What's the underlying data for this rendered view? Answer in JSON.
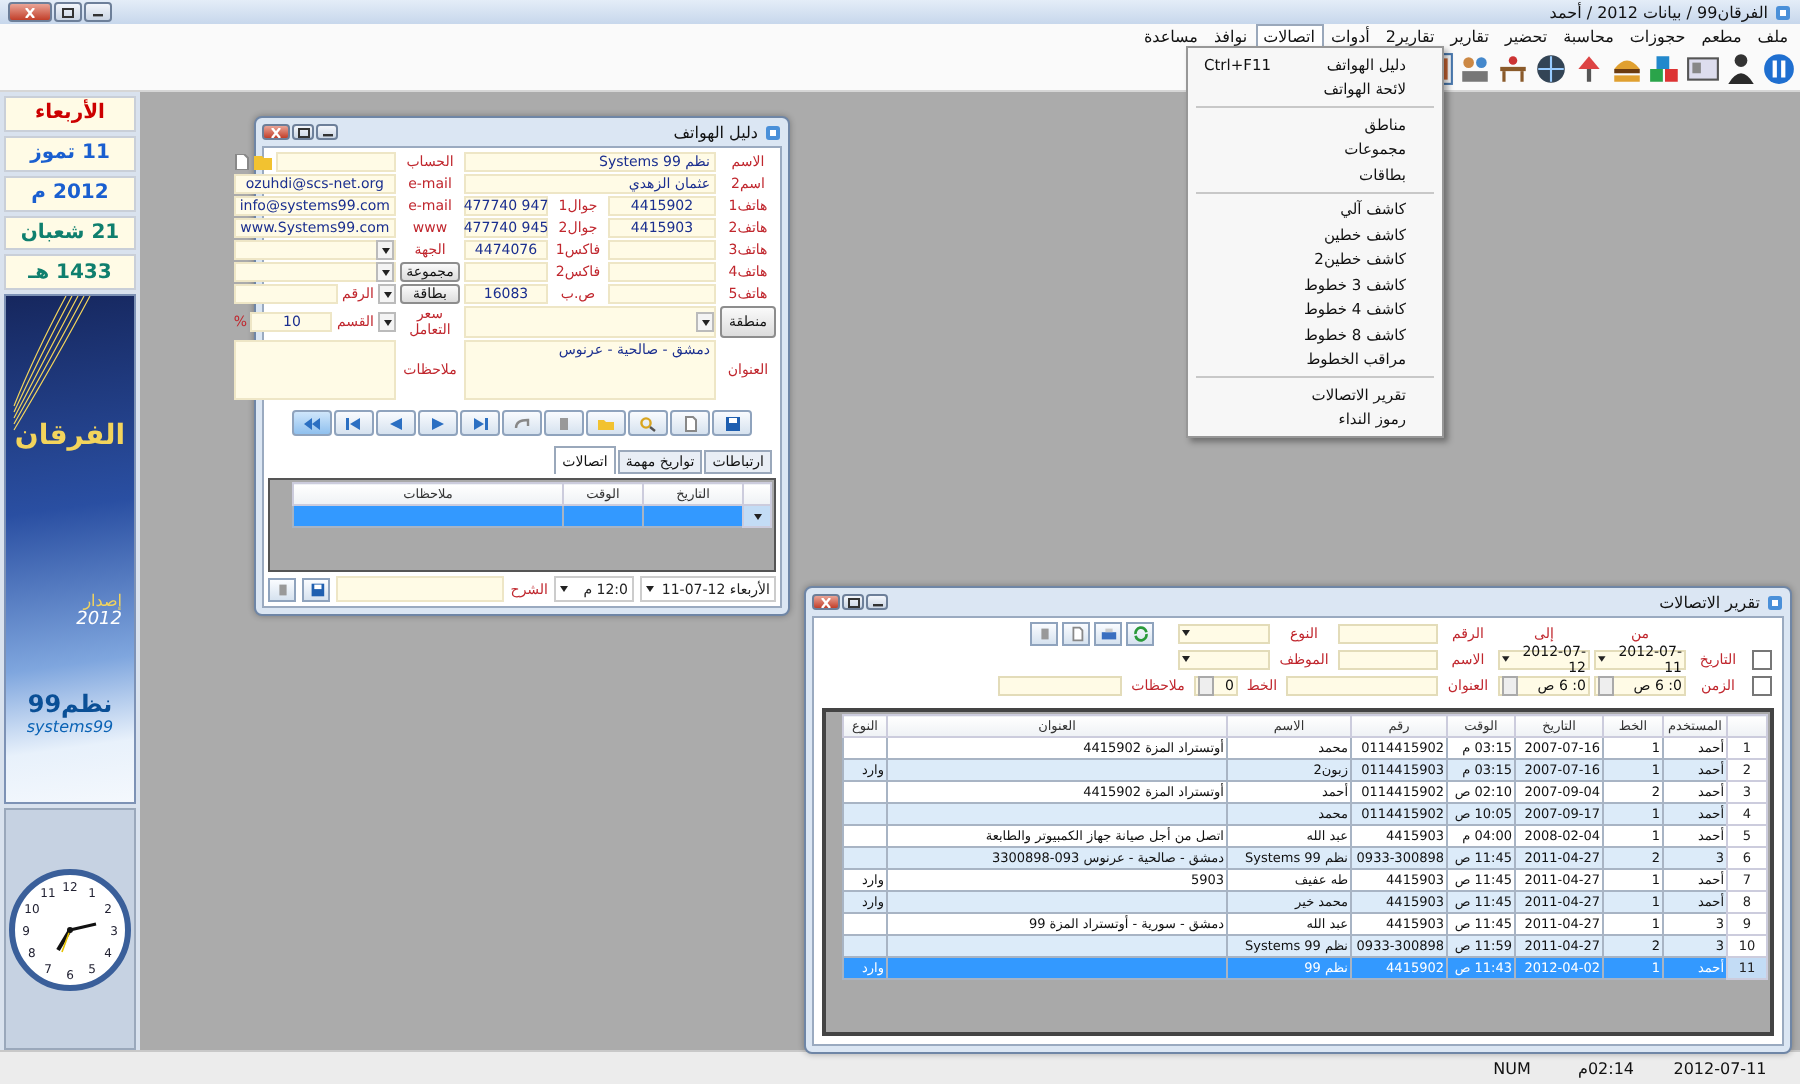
{
  "window": {
    "title": "الفرقان99 / بيانات 2012 / أحمد"
  },
  "menu": [
    {
      "label": "ملف",
      "selected": false
    },
    {
      "label": "مطعم",
      "selected": false
    },
    {
      "label": "حجوزات",
      "selected": false
    },
    {
      "label": "محاسبة",
      "selected": false
    },
    {
      "label": "تحضير",
      "selected": false
    },
    {
      "label": "تقارير",
      "selected": false
    },
    {
      "label": "تقارير2",
      "selected": false
    },
    {
      "label": "أدوات",
      "selected": false
    },
    {
      "label": "اتصالات",
      "selected": true
    },
    {
      "label": "نوافذ",
      "selected": false
    },
    {
      "label": "مساعدة",
      "selected": false
    }
  ],
  "dropdown": [
    {
      "kind": "item",
      "label": "دليل الهواتف",
      "shortcut": "Ctrl+F11"
    },
    {
      "kind": "item",
      "label": "لائحة الهواتف"
    },
    {
      "kind": "separator"
    },
    {
      "kind": "item",
      "label": "مناطق"
    },
    {
      "kind": "item",
      "label": "مجموعات"
    },
    {
      "kind": "item",
      "label": "بطاقات"
    },
    {
      "kind": "separator"
    },
    {
      "kind": "item",
      "label": "كاشف آلي"
    },
    {
      "kind": "item",
      "label": "كاشف خطين"
    },
    {
      "kind": "item",
      "label": "كاشف خطين2"
    },
    {
      "kind": "item",
      "label": "كاشف 3 خطوط"
    },
    {
      "kind": "item",
      "label": "كاشف 4 خطوط"
    },
    {
      "kind": "item",
      "label": "كاشف 8 خطوط"
    },
    {
      "kind": "item",
      "label": "مراقب الخطوط"
    },
    {
      "kind": "separator"
    },
    {
      "kind": "item",
      "label": "تقرير الاتصالات"
    },
    {
      "kind": "item",
      "label": "رموز النداء"
    }
  ],
  "sidebar": {
    "dates": [
      {
        "text": "الأربعاء",
        "color": "#cc0000"
      },
      {
        "text": "11 تموز",
        "color": "#1a5fd0"
      },
      {
        "text": "2012 م",
        "color": "#1a5fd0"
      },
      {
        "text": "21 شعبان",
        "color": "#0f7f6e"
      },
      {
        "text": "1433 هـ",
        "color": "#0f7f6e"
      }
    ],
    "banner": {
      "title": "الفرقان",
      "edition": "إصدار",
      "year": "2012",
      "brand": "نظم99",
      "brand_latin": "systems99"
    },
    "clock": {
      "numerals": [
        "12",
        "1",
        "2",
        "3",
        "4",
        "5",
        "6",
        "7",
        "8",
        "9",
        "10",
        "11"
      ]
    }
  },
  "phone_book": {
    "title": "دليل الهواتف",
    "form": [
      [
        {
          "kind": "label",
          "text": "الاسم"
        },
        {
          "kind": "wide_field",
          "value": "نظم 99 Systems"
        },
        {
          "kind": "label",
          "text": "الحساب"
        },
        {
          "kind": "icon_field"
        }
      ],
      [
        {
          "kind": "label",
          "text": "اسم2"
        },
        {
          "kind": "wide_field",
          "value": "عثمان الزهدي"
        },
        {
          "kind": "label",
          "text": "e-mail"
        },
        {
          "kind": "field",
          "value": "ozuhdi@scs-net.org"
        }
      ],
      [
        {
          "kind": "label",
          "text": "هاتف1"
        },
        {
          "kind": "field",
          "value": "4415902"
        },
        {
          "kind": "label",
          "text": "جوال1"
        },
        {
          "kind": "field",
          "value": "947 477740"
        },
        {
          "kind": "label",
          "text": "e-mail"
        },
        {
          "kind": "field",
          "value": "info@systems99.com"
        }
      ],
      [
        {
          "kind": "label",
          "text": "هاتف2"
        },
        {
          "kind": "field",
          "value": "4415903"
        },
        {
          "kind": "label",
          "text": "جوال2"
        },
        {
          "kind": "field",
          "value": "945 477740"
        },
        {
          "kind": "label",
          "text": "www"
        },
        {
          "kind": "field",
          "value": "www.Systems99.com"
        }
      ],
      [
        {
          "kind": "label",
          "text": "هاتف3"
        },
        {
          "kind": "field"
        },
        {
          "kind": "label",
          "text": "فاكس1"
        },
        {
          "kind": "field",
          "value": "4474076"
        },
        {
          "kind": "label",
          "text": "الجهة"
        },
        {
          "kind": "select"
        }
      ],
      [
        {
          "kind": "label",
          "text": "هاتف4"
        },
        {
          "kind": "field"
        },
        {
          "kind": "label",
          "text": "فاكس2"
        },
        {
          "kind": "field"
        },
        {
          "kind": "button",
          "text": "مجموعة"
        },
        {
          "kind": "select"
        }
      ],
      [
        {
          "kind": "label",
          "text": "هاتف5"
        },
        {
          "kind": "field"
        },
        {
          "kind": "label",
          "text": "ص.ب"
        },
        {
          "kind": "field",
          "value": "16083"
        },
        {
          "kind": "button",
          "text": "بطاقة"
        },
        {
          "kind": "number_select",
          "text": "الرقم"
        }
      ],
      [
        {
          "kind": "button",
          "text": "منطقة"
        },
        {
          "kind": "wide_select"
        },
        {
          "kind": "label",
          "text": "سعر التعامل"
        },
        {
          "kind": "percent_field",
          "text": "القسم",
          "value": "10",
          "unit": "%"
        }
      ],
      [
        {
          "kind": "label",
          "text": "العنوان"
        },
        {
          "kind": "wide_area",
          "value": "دمشق - صالحية - عرنوس"
        },
        {
          "kind": "label",
          "text": "ملاحظات"
        },
        {
          "kind": "area"
        }
      ]
    ],
    "tabs": [
      {
        "label": "ارتباطات",
        "selected": false
      },
      {
        "label": "تواريخ مهمة",
        "selected": false
      },
      {
        "label": "اتصالات",
        "selected": true
      }
    ],
    "grid": {
      "columns": [
        "التاريخ",
        "الوقت",
        "ملاحظات"
      ],
      "rows": [
        {
          "selected": true
        }
      ]
    },
    "footer": {
      "date": "الأربعاء 12-07-11",
      "time": "12:0 م",
      "description_label": "الشرح"
    }
  },
  "report": {
    "title": "تقرير الاتصالات",
    "filters": {
      "from_label": "من",
      "to_label": "إلى",
      "date": {
        "label": "التاريخ",
        "checked": false,
        "from": "2012-07-11",
        "to": "2012-07-12"
      },
      "time": {
        "label": "الزمن",
        "checked": false,
        "from": "0: 6 ص",
        "to": "0: 6 ص"
      },
      "number_label": "الرقم",
      "name_label": "الاسم",
      "address_label": "العنوان",
      "type_label": "النوع",
      "employee_label": "الموظف",
      "line": {
        "label": "الخط",
        "value": "0"
      },
      "notes_label": "ملاحظات"
    },
    "columns": [
      "المستخدم",
      "الخط",
      "التاريخ",
      "الوقت",
      "رقم",
      "الاسم",
      "العنوان",
      "النوع"
    ],
    "rows": [
      {
        "number": "1",
        "selected": false,
        "cells": [
          "أحمد",
          "1",
          "2007-07-16",
          "03:15 م",
          "0114415902",
          "محمد",
          "أوتستراد المزة 4415902",
          ""
        ]
      },
      {
        "number": "2",
        "selected": false,
        "cells": [
          "أحمد",
          "1",
          "2007-07-16",
          "03:15 م",
          "0114415903",
          "زبون2",
          "",
          "وارد"
        ]
      },
      {
        "number": "3",
        "selected": false,
        "cells": [
          "أحمد",
          "2",
          "2007-09-04",
          "02:10 ص",
          "0114415902",
          "أحمد",
          "أوتستراد المزة 4415902",
          ""
        ]
      },
      {
        "number": "4",
        "selected": false,
        "cells": [
          "أحمد",
          "1",
          "2007-09-17",
          "10:05 ص",
          "0114415902",
          "محمد",
          "",
          ""
        ]
      },
      {
        "number": "5",
        "selected": false,
        "cells": [
          "أحمد",
          "1",
          "2008-02-04",
          "04:00 م",
          "4415903",
          "عبد الله",
          "اتصل من أجل صيانة جهاز الكمبيوتر والطابعة",
          ""
        ]
      },
      {
        "number": "6",
        "selected": false,
        "cells": [
          "3",
          "2",
          "2011-04-27",
          "11:45 ص",
          "0933-300898",
          "نظم 99 Systems",
          "دمشق - صالحية - عرنوس 093-3300898",
          ""
        ]
      },
      {
        "number": "7",
        "selected": false,
        "cells": [
          "أحمد",
          "1",
          "2011-04-27",
          "11:45 ص",
          "4415903",
          "طه عفيف",
          "5903",
          "وارد"
        ]
      },
      {
        "number": "8",
        "selected": false,
        "cells": [
          "أحمد",
          "1",
          "2011-04-27",
          "11:45 ص",
          "4415903",
          "محمد خير",
          "",
          "وارد"
        ]
      },
      {
        "number": "9",
        "selected": false,
        "cells": [
          "3",
          "1",
          "2011-04-27",
          "11:45 ص",
          "4415903",
          "عبد الله",
          "دمشق - سورية - أوتستراد المزة 99",
          ""
        ]
      },
      {
        "number": "10",
        "selected": false,
        "cells": [
          "3",
          "2",
          "2011-04-27",
          "11:59 ص",
          "0933-300898",
          "نظم 99 Systems",
          "",
          ""
        ]
      },
      {
        "number": "11",
        "selected": true,
        "cells": [
          "أحمد",
          "1",
          "2012-04-02",
          "11:43 ص",
          "4415902",
          "نظم 99",
          "",
          "وارد"
        ]
      }
    ]
  },
  "status_bar": {
    "keys": "NUM",
    "time": "02:14م",
    "date": "2012-07-11"
  }
}
